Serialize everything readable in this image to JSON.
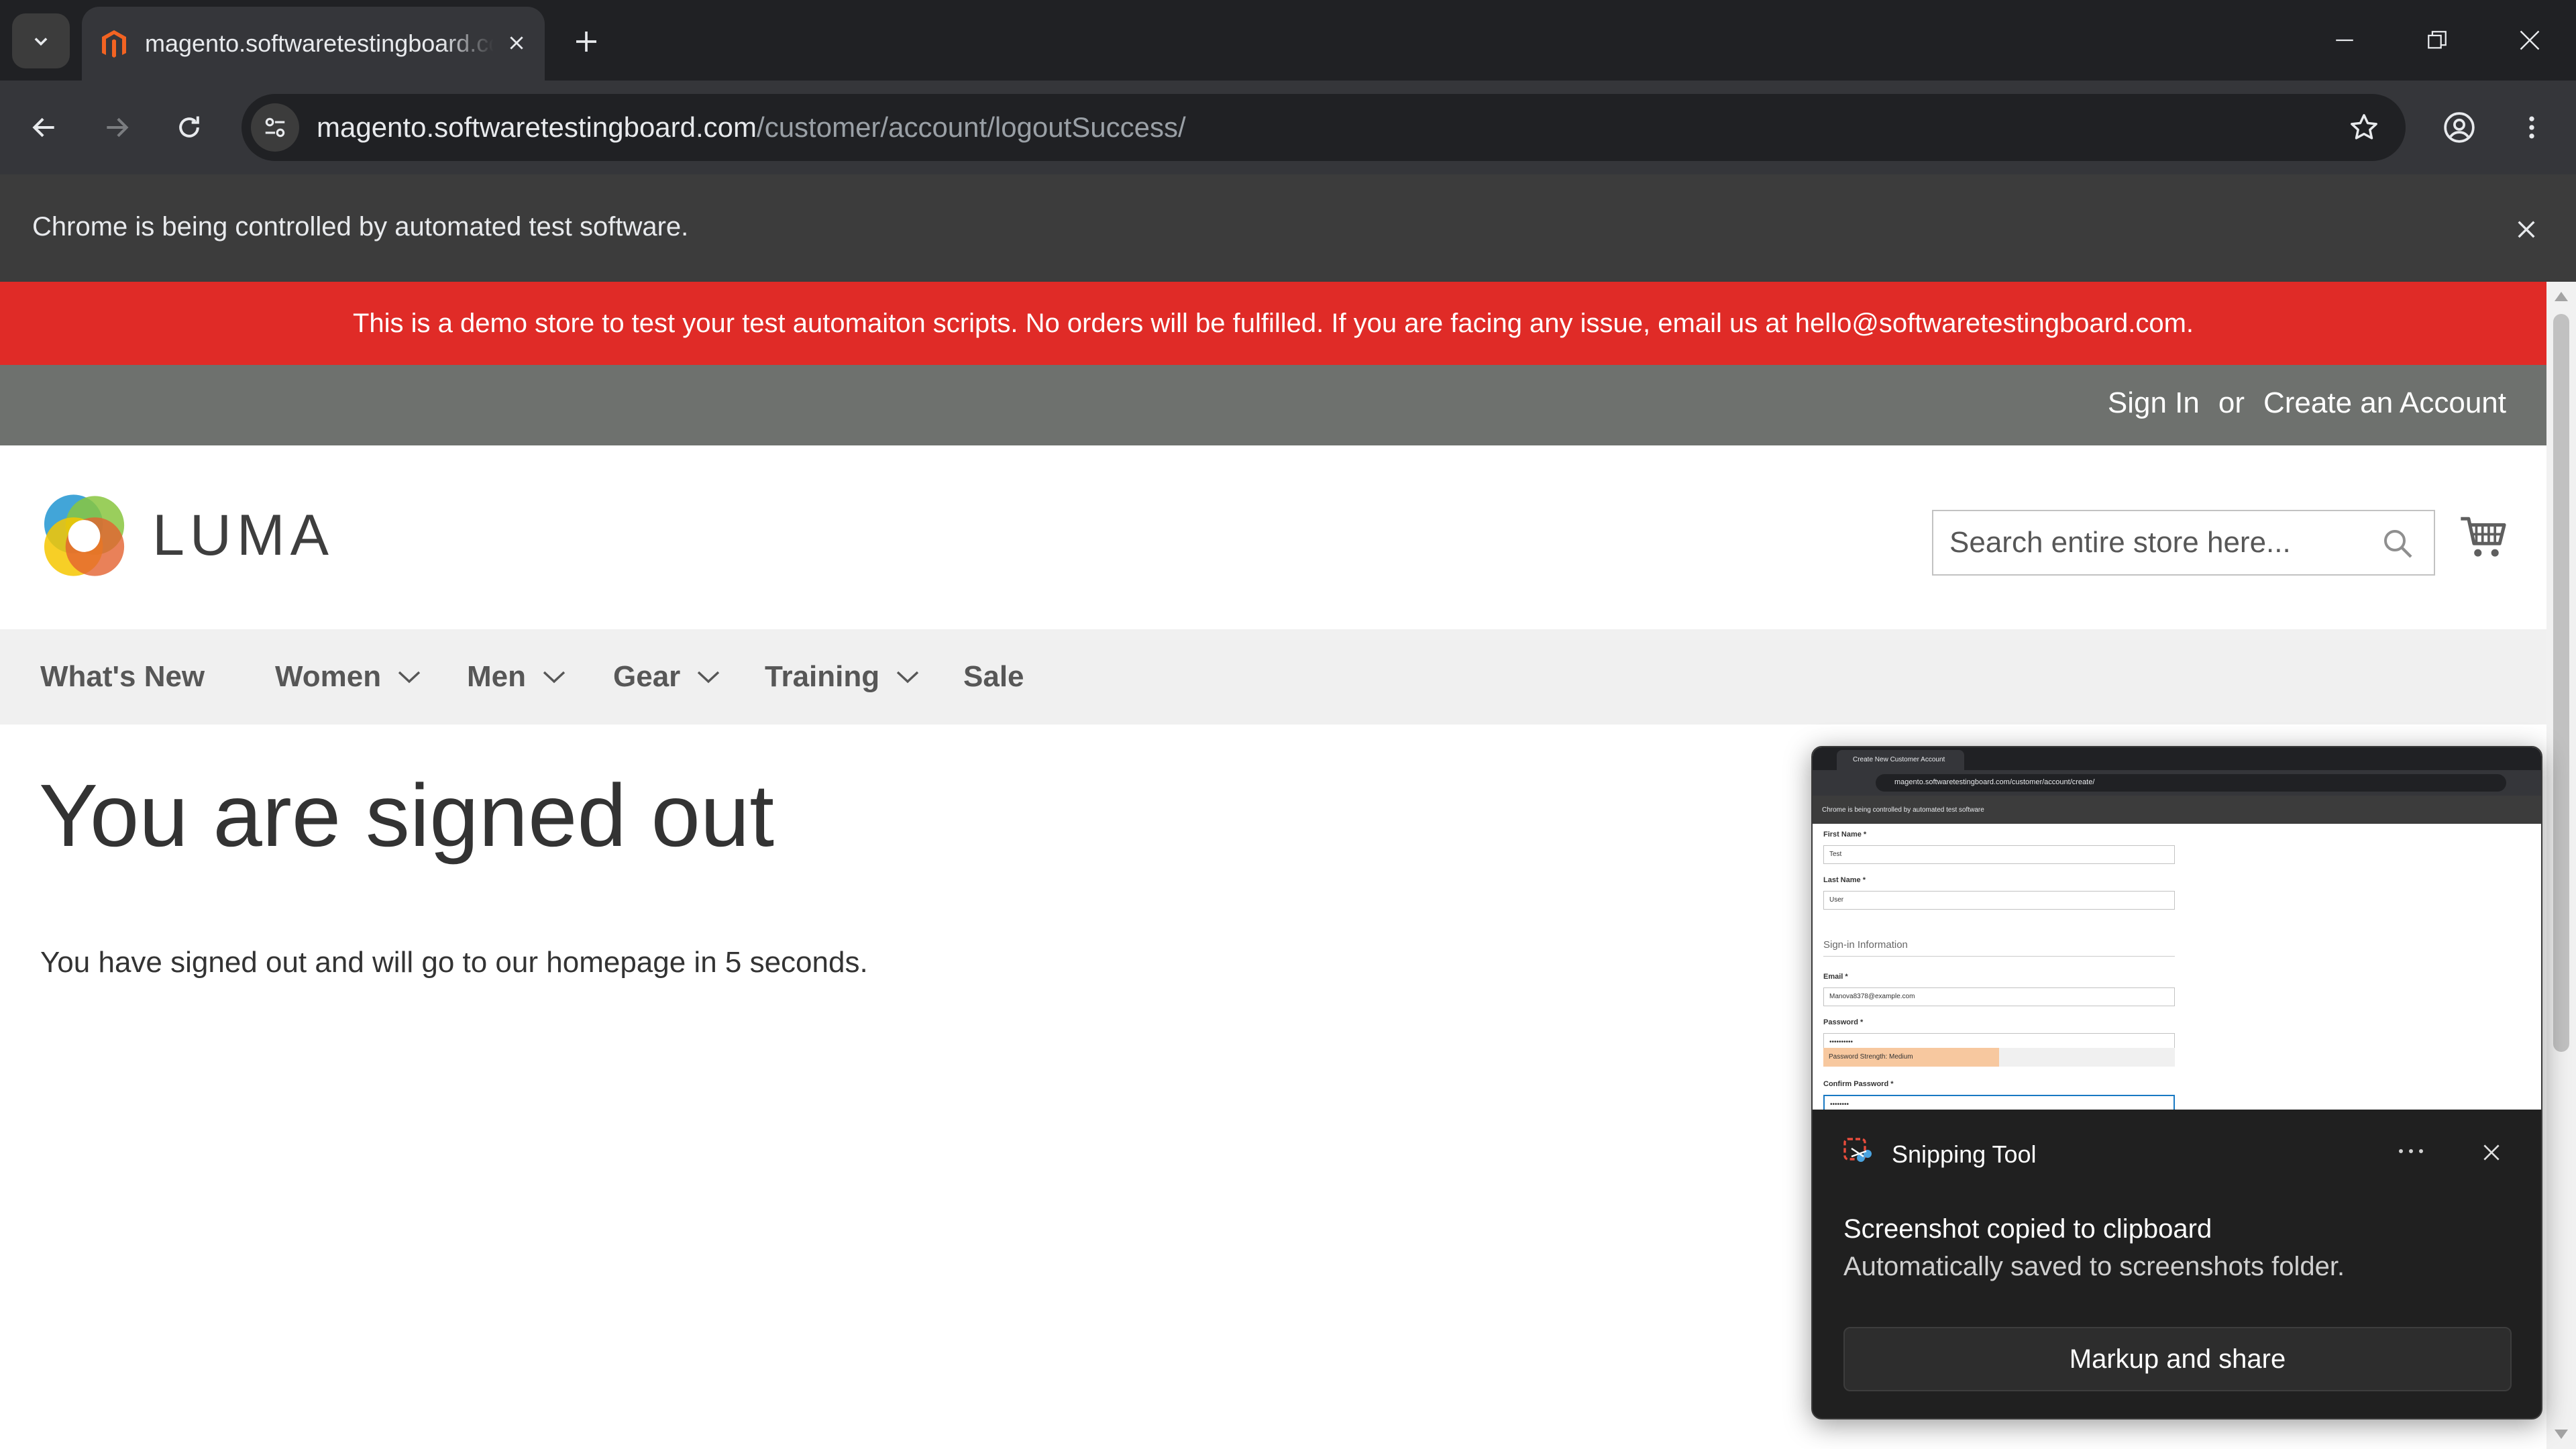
{
  "browser": {
    "tab_title": "magento.softwaretestingboard.com",
    "url_host": "magento.softwaretestingboard.com",
    "url_path": "/customer/account/logoutSuccess/",
    "automation_notice": "Chrome is being controlled by automated test software."
  },
  "page": {
    "demo_banner": "This is a demo store to test your test automaiton scripts. No orders will be fulfilled. If you are facing any issue, email us at hello@softwaretestingboard.com.",
    "header": {
      "sign_in": "Sign In",
      "or": "or",
      "create_account": "Create an Account"
    },
    "logo_text": "LUMA",
    "search_placeholder": "Search entire store here...",
    "nav": [
      {
        "label": "What's New",
        "has_dropdown": false
      },
      {
        "label": "Women",
        "has_dropdown": true
      },
      {
        "label": "Men",
        "has_dropdown": true
      },
      {
        "label": "Gear",
        "has_dropdown": true
      },
      {
        "label": "Training",
        "has_dropdown": true
      },
      {
        "label": "Sale",
        "has_dropdown": false
      }
    ],
    "title": "You are signed out",
    "message": "You have signed out and will go to our homepage in 5 seconds."
  },
  "notification": {
    "app_name": "Snipping Tool",
    "title": "Screenshot copied to clipboard",
    "body": "Automatically saved to screenshots folder.",
    "button": "Markup and share",
    "preview": {
      "tab_title": "Create New Customer Account",
      "url": "magento.softwaretestingboard.com/customer/account/create/",
      "automation_notice": "Chrome is being controlled by automated test software",
      "first_name_label": "First Name *",
      "first_name_value": "Test",
      "last_name_label": "Last Name *",
      "last_name_value": "User",
      "section_title": "Sign-in Information",
      "email_label": "Email *",
      "email_value": "Manova8378@example.com",
      "password_label": "Password *",
      "password_value": "••••••••••",
      "strength_text": "Password Strength: Medium",
      "confirm_label": "Confirm Password *",
      "confirm_value": "••••••••"
    }
  },
  "colors": {
    "demo_banner": "#e02b27",
    "header_panel": "#6e716e",
    "nav_bg": "#f0f0f0",
    "browser_dark": "#202124"
  }
}
